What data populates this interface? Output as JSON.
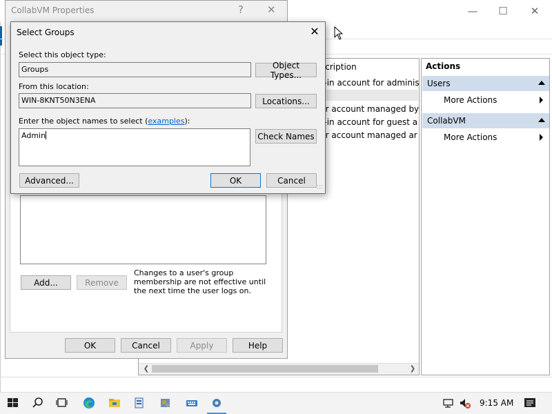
{
  "main_window": {
    "list": {
      "header_description": "scription",
      "rows": [
        "ilt-in account for adminis",
        "ser account managed by",
        "ilt-in account for guest a",
        "ser account managed ar"
      ]
    },
    "actions": {
      "title": "Actions",
      "sections": [
        {
          "label": "Users",
          "item": "More Actions"
        },
        {
          "label": "CollabVM",
          "item": "More Actions"
        }
      ]
    }
  },
  "properties_dialog": {
    "title": "CollabVM Properties",
    "help_glyph": "?",
    "add_label": "Add...",
    "remove_label": "Remove",
    "note": "Changes to a user's group membership are not effective until the next time the user logs on.",
    "ok_label": "OK",
    "cancel_label": "Cancel",
    "apply_label": "Apply",
    "help_label": "Help"
  },
  "select_groups": {
    "title": "Select Groups",
    "object_type_label": "Select this object type:",
    "object_type_value": "Groups",
    "object_types_button": "Object Types...",
    "location_label": "From this location:",
    "location_value": "WIN-8KNT50N3ENA",
    "locations_button": "Locations...",
    "names_label_prefix": "Enter the object names to select (",
    "names_label_link": "examples",
    "names_label_suffix": "):",
    "names_value": "Admin",
    "check_names_button": "Check Names",
    "advanced_button": "Advanced...",
    "ok_button": "OK",
    "cancel_button": "Cancel"
  },
  "taskbar": {
    "time": "9:15 AM"
  },
  "colors": {
    "accent": "#0078d7",
    "section_bg": "#cfdcec",
    "dialog_bg": "#f0f0f0",
    "link": "#0066cc"
  },
  "icons": [
    "windows-start-icon",
    "search-icon",
    "task-view-icon",
    "edge-icon",
    "file-explorer-icon",
    "server-manager-icon",
    "cmd-icon",
    "keyboard-icon",
    "settings-icon",
    "network-icon",
    "volume-muted-icon",
    "notification-icon"
  ]
}
